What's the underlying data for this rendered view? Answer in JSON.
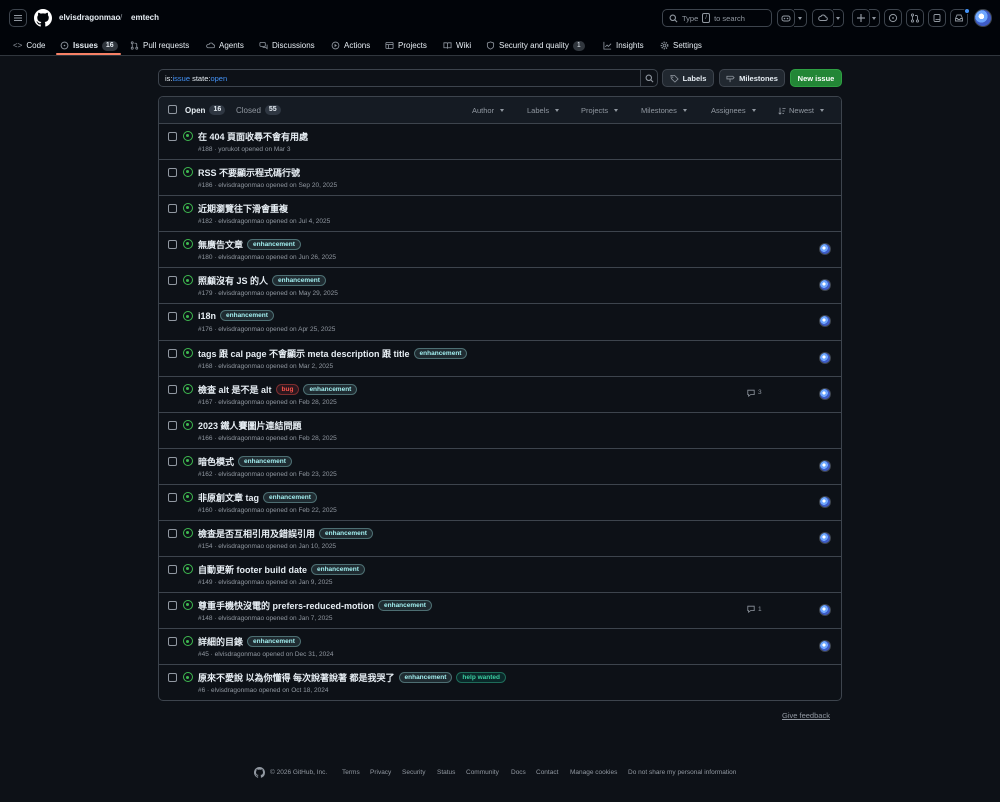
{
  "header": {
    "owner": "elvisdragonmao",
    "separator": "/",
    "repo": "emtech",
    "search_placeholder": "Type",
    "search_key": "/",
    "search_suffix": "to search"
  },
  "nav": {
    "code": "Code",
    "issues": "Issues",
    "issues_count": "16",
    "pulls": "Pull requests",
    "agents": "Agents",
    "discussions": "Discussions",
    "actions": "Actions",
    "projects": "Projects",
    "wiki": "Wiki",
    "security": "Security and quality",
    "security_count": "1",
    "insights": "Insights",
    "settings": "Settings"
  },
  "filter": {
    "k1": "is:",
    "v1": "issue",
    "k2": " state:",
    "v2": "open"
  },
  "buttons": {
    "labels": "Labels",
    "milestones": "Milestones",
    "new_issue": "New issue"
  },
  "list_header": {
    "open_label": "Open",
    "open_count": "16",
    "closed_label": "Closed",
    "closed_count": "55",
    "author": "Author",
    "labels": "Labels",
    "projects": "Projects",
    "milestones": "Milestones",
    "assignees": "Assignees",
    "sort": "Newest"
  },
  "issues": [
    {
      "title": "在 404 頁面收尋不會有用處",
      "labels": [],
      "meta": "#188 · yorukot opened on Mar 3",
      "comments": "",
      "assignee": false
    },
    {
      "title": "RSS 不要顯示程式碼行號",
      "labels": [],
      "meta": "#186 · elvisdragonmao opened on Sep 20, 2025",
      "comments": "",
      "assignee": false
    },
    {
      "title": "近期瀏覽往下滑會重複",
      "labels": [],
      "meta": "#182 · elvisdragonmao opened on Jul 4, 2025",
      "comments": "",
      "assignee": false
    },
    {
      "title": "無廣告文章",
      "labels": [
        "enhancement"
      ],
      "meta": "#180 · elvisdragonmao opened on Jun 26, 2025",
      "comments": "",
      "assignee": true
    },
    {
      "title": "照顧沒有 JS 的人",
      "labels": [
        "enhancement"
      ],
      "meta": "#179 · elvisdragonmao opened on May 29, 2025",
      "comments": "",
      "assignee": true
    },
    {
      "title": "i18n",
      "labels": [
        "enhancement"
      ],
      "meta": "#176 · elvisdragonmao opened on Apr 25, 2025",
      "comments": "",
      "assignee": true
    },
    {
      "title": "tags 跟 cal page 不會顯示 meta description 跟 title",
      "labels": [
        "enhancement"
      ],
      "meta": "#168 · elvisdragonmao opened on Mar 2, 2025",
      "comments": "",
      "assignee": true
    },
    {
      "title": "檢查 alt 是不是 alt",
      "labels": [
        "bug",
        "enhancement"
      ],
      "meta": "#167 · elvisdragonmao opened on Feb 28, 2025",
      "comments": "3",
      "assignee": true
    },
    {
      "title": "2023 鐵人賽圖片連結問題",
      "labels": [],
      "meta": "#166 · elvisdragonmao opened on Feb 28, 2025",
      "comments": "",
      "assignee": false
    },
    {
      "title": "暗色模式",
      "labels": [
        "enhancement"
      ],
      "meta": "#162 · elvisdragonmao opened on Feb 23, 2025",
      "comments": "",
      "assignee": true
    },
    {
      "title": "非原創文章 tag",
      "labels": [
        "enhancement"
      ],
      "meta": "#160 · elvisdragonmao opened on Feb 22, 2025",
      "comments": "",
      "assignee": true
    },
    {
      "title": "檢查是否互相引用及錯誤引用",
      "labels": [
        "enhancement"
      ],
      "meta": "#154 · elvisdragonmao opened on Jan 10, 2025",
      "comments": "",
      "assignee": true
    },
    {
      "title": "自動更新 footer build date",
      "labels": [
        "enhancement"
      ],
      "meta": "#149 · elvisdragonmao opened on Jan 9, 2025",
      "comments": "",
      "assignee": false
    },
    {
      "title": "尊重手機快沒電的 prefers-reduced-motion",
      "labels": [
        "enhancement"
      ],
      "meta": "#148 · elvisdragonmao opened on Jan 7, 2025",
      "comments": "1",
      "assignee": true
    },
    {
      "title": "詳細的目錄",
      "labels": [
        "enhancement"
      ],
      "meta": "#45 · elvisdragonmao opened on Dec 31, 2024",
      "comments": "",
      "assignee": true
    },
    {
      "title": "原來不愛說 以為你懂得 每次說著說著 都是我哭了",
      "labels": [
        "enhancement",
        "help wanted"
      ],
      "meta": "#6 · elvisdragonmao opened on Oct 18, 2024",
      "comments": "",
      "assignee": false
    }
  ],
  "feedback": "Give feedback",
  "footer": {
    "copyright": "© 2026 GitHub, Inc.",
    "links": [
      "Terms",
      "Privacy",
      "Security",
      "Status",
      "Community",
      "Docs",
      "Contact",
      "Manage cookies",
      "Do not share my personal information"
    ]
  },
  "colors": {
    "accent": "#4493f8",
    "open_green": "#3fb950",
    "new_issue_green": "#238636",
    "active_tab": "#f78166"
  }
}
